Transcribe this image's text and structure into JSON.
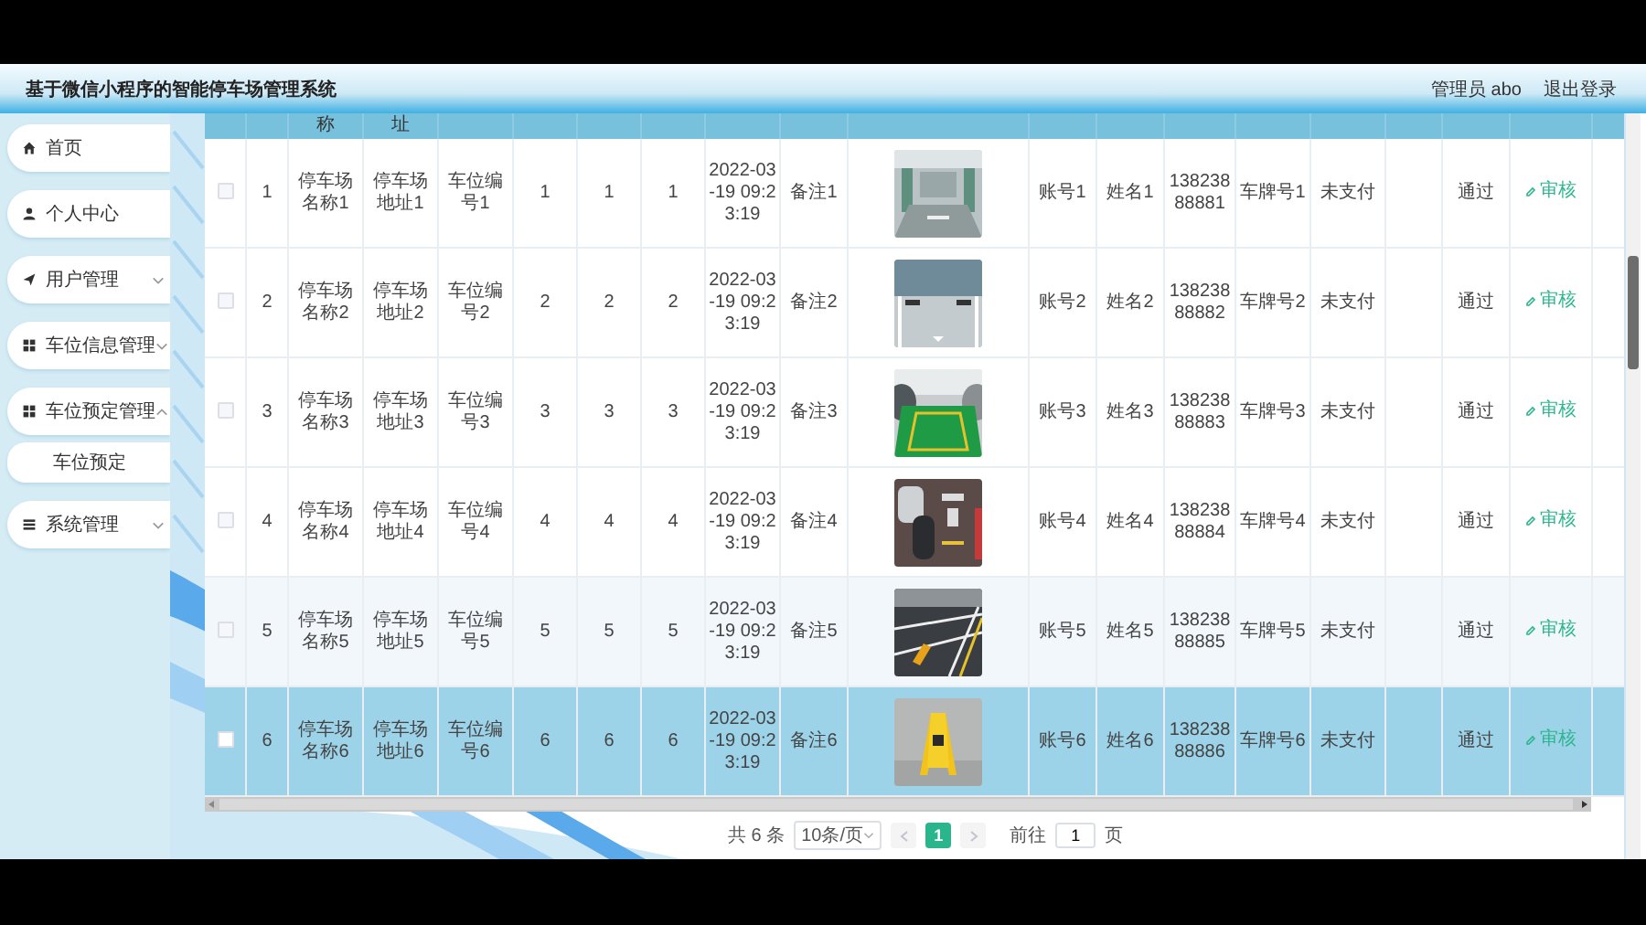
{
  "window": {
    "title": "基于微信小程序的智能停车场管理系统"
  },
  "header": {
    "user": "管理员 abo",
    "logout": "退出登录"
  },
  "sidebar": {
    "items": [
      {
        "label": "首页"
      },
      {
        "label": "个人中心"
      },
      {
        "label": "用户管理",
        "expanded": false
      },
      {
        "label": "车位信息管理",
        "expanded": false
      },
      {
        "label": "车位预定管理",
        "expanded": true,
        "children": [
          {
            "label": "车位预定"
          }
        ]
      },
      {
        "label": "系统管理",
        "expanded": false
      }
    ]
  },
  "table": {
    "header": {
      "column_3": "称",
      "column_4": "址"
    },
    "rows": [
      {
        "checked": false,
        "striped": false,
        "hovered": false,
        "index": "1",
        "name": "停车场名称1",
        "address": "停车场地址1",
        "space_no": "车位编号1",
        "column_6": "1",
        "column_7": "1",
        "column_8": "1",
        "time": "2022-03-19 09:23:19",
        "remark": "备注1",
        "account": "账号1",
        "person": "姓名1",
        "phone": "13823888881",
        "plate": "车牌号1",
        "payment": "未支付",
        "review": "通过",
        "action": "审核"
      },
      {
        "checked": false,
        "striped": false,
        "hovered": false,
        "index": "2",
        "name": "停车场名称2",
        "address": "停车场地址2",
        "space_no": "车位编号2",
        "column_6": "2",
        "column_7": "2",
        "column_8": "2",
        "time": "2022-03-19 09:23:19",
        "remark": "备注2",
        "account": "账号2",
        "person": "姓名2",
        "phone": "13823888882",
        "plate": "车牌号2",
        "payment": "未支付",
        "review": "通过",
        "action": "审核"
      },
      {
        "checked": false,
        "striped": false,
        "hovered": false,
        "index": "3",
        "name": "停车场名称3",
        "address": "停车场地址3",
        "space_no": "车位编号3",
        "column_6": "3",
        "column_7": "3",
        "column_8": "3",
        "time": "2022-03-19 09:23:19",
        "remark": "备注3",
        "account": "账号3",
        "person": "姓名3",
        "phone": "13823888883",
        "plate": "车牌号3",
        "payment": "未支付",
        "review": "通过",
        "action": "审核"
      },
      {
        "checked": false,
        "striped": false,
        "hovered": false,
        "index": "4",
        "name": "停车场名称4",
        "address": "停车场地址4",
        "space_no": "车位编号4",
        "column_6": "4",
        "column_7": "4",
        "column_8": "4",
        "time": "2022-03-19 09:23:19",
        "remark": "备注4",
        "account": "账号4",
        "person": "姓名4",
        "phone": "13823888884",
        "plate": "车牌号4",
        "payment": "未支付",
        "review": "通过",
        "action": "审核"
      },
      {
        "checked": false,
        "striped": true,
        "hovered": false,
        "index": "5",
        "name": "停车场名称5",
        "address": "停车场地址5",
        "space_no": "车位编号5",
        "column_6": "5",
        "column_7": "5",
        "column_8": "5",
        "time": "2022-03-19 09:23:19",
        "remark": "备注5",
        "account": "账号5",
        "person": "姓名5",
        "phone": "13823888885",
        "plate": "车牌号5",
        "payment": "未支付",
        "review": "通过",
        "action": "审核"
      },
      {
        "checked": false,
        "striped": false,
        "hovered": true,
        "index": "6",
        "name": "停车场名称6",
        "address": "停车场地址6",
        "space_no": "车位编号6",
        "column_6": "6",
        "column_7": "6",
        "column_8": "6",
        "time": "2022-03-19 09:23:19",
        "remark": "备注6",
        "account": "账号6",
        "person": "姓名6",
        "phone": "13823888886",
        "plate": "车牌号6",
        "payment": "未支付",
        "review": "通过",
        "action": "审核"
      }
    ]
  },
  "pagination": {
    "total": "共 6 条",
    "page_size": "10条/页",
    "prev_disabled": true,
    "next_disabled": true,
    "pages": [
      {
        "label": "1",
        "selected": true
      }
    ],
    "goto_label": "前往",
    "goto_value": "1",
    "goto_suffix": "页"
  }
}
